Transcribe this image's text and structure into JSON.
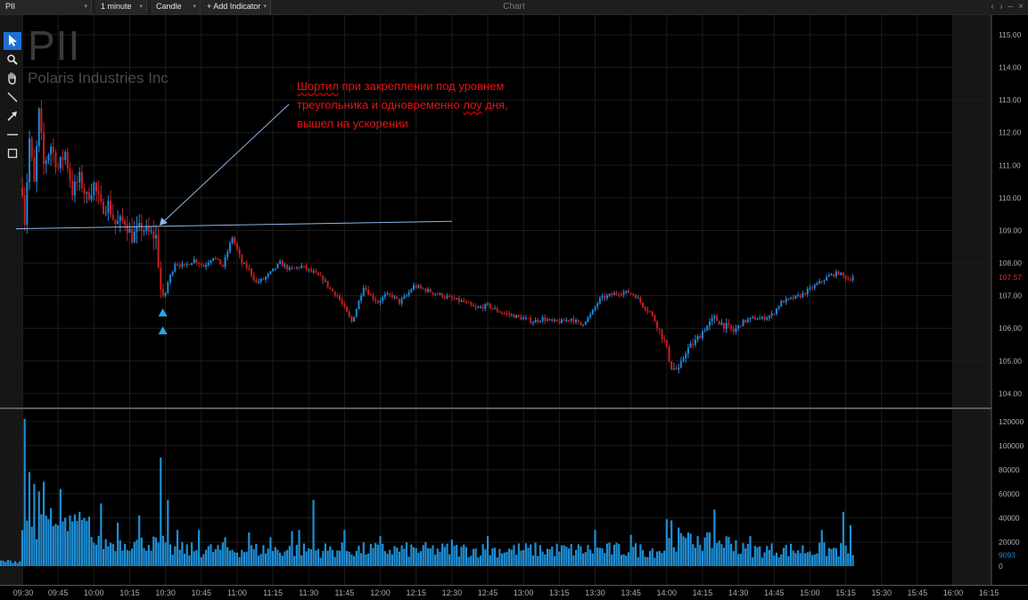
{
  "toolbar": {
    "symbol": "PII",
    "interval": "1 minute",
    "chart_style": "Candle",
    "add_indicator": "+ Add Indicator",
    "window_title": "Chart"
  },
  "tools": [
    "pointer-icon",
    "zoom-icon",
    "hand-icon",
    "line-icon",
    "arrow-icon",
    "horizontal-line-icon",
    "rectangle-icon"
  ],
  "header": {
    "symbol": "PII",
    "company": "Polaris Industries Inc"
  },
  "annotation": {
    "word1": "Шортил",
    "part1": " при закреплении под уровнем треугольника и одновременно ",
    "word2": "лоу",
    "part2": " дня, вышел на ускорении"
  },
  "colors": {
    "up": "#1e88d8",
    "down": "#c81e1e",
    "volume": "#1e8fd6",
    "grid": "#1c1c1c",
    "annotation_line": "#8ab8e6",
    "marker": "#2aa4ea",
    "price_label": "#d23232"
  },
  "chart_data": {
    "type": "candlestick",
    "symbol": "PII",
    "interval": "1 minute",
    "title": "",
    "xlabel": "",
    "ylabel": "",
    "price_ylim": [
      103.6,
      115.6
    ],
    "price_ticks": [
      115,
      114,
      113,
      112,
      111,
      110,
      109,
      108,
      107,
      106,
      105,
      104
    ],
    "price_tick_labels": [
      "115.00",
      "114.00",
      "113.00",
      "112.00",
      "111.00",
      "110.00",
      "109.00",
      "108.00",
      "107.00",
      "106.00",
      "105.00",
      "104.00"
    ],
    "last_price": 107.57,
    "last_price_label": "107.57",
    "volume_ylim": [
      0,
      125000
    ],
    "volume_ticks": [
      0,
      20000,
      40000,
      60000,
      80000,
      100000,
      120000
    ],
    "volume_tick_labels": [
      "0",
      "20000",
      "40000",
      "60000",
      "80000",
      "100000",
      "120000"
    ],
    "last_volume": 9093,
    "last_volume_label": "9093",
    "x_ticks": [
      "09:30",
      "09:45",
      "10:00",
      "10:15",
      "10:30",
      "10:45",
      "11:00",
      "11:15",
      "11:30",
      "11:45",
      "12:00",
      "12:15",
      "12:30",
      "12:45",
      "13:00",
      "13:15",
      "13:30",
      "13:45",
      "14:00",
      "14:15",
      "14:30",
      "14:45",
      "15:00",
      "15:15",
      "15:30",
      "15:45",
      "16:00",
      "16:15"
    ],
    "session": [
      "09:30",
      "16:00"
    ],
    "level_line": {
      "type": "horizontal-trendline",
      "start": [
        "09:30",
        109.05
      ],
      "end": [
        "12:30",
        109.28
      ]
    },
    "arrow": {
      "from": [
        "11:45",
        112.0
      ],
      "to": [
        "10:32",
        109.05
      ]
    },
    "markers": [
      {
        "time": "10:30",
        "price": 106.5,
        "shape": "triangle-up"
      },
      {
        "time": "10:30",
        "price": 105.95,
        "shape": "triangle-up"
      }
    ],
    "price_path": [
      [
        "09:30",
        110.3
      ],
      [
        "09:31",
        109.3
      ],
      [
        "09:33",
        111.8
      ],
      [
        "09:35",
        110.4
      ],
      [
        "09:37",
        112.6
      ],
      [
        "09:39",
        111.0
      ],
      [
        "09:42",
        111.6
      ],
      [
        "09:45",
        110.9
      ],
      [
        "09:48",
        111.4
      ],
      [
        "09:51",
        110.2
      ],
      [
        "09:54",
        110.6
      ],
      [
        "09:57",
        110.0
      ],
      [
        "10:00",
        110.4
      ],
      [
        "10:03",
        109.7
      ],
      [
        "10:06",
        109.8
      ],
      [
        "10:09",
        109.2
      ],
      [
        "10:13",
        109.3
      ],
      [
        "10:16",
        108.8
      ],
      [
        "10:20",
        109.1
      ],
      [
        "10:23",
        108.9
      ],
      [
        "10:26",
        108.8
      ],
      [
        "10:27",
        108.0
      ],
      [
        "10:28",
        107.2
      ],
      [
        "10:29",
        106.8
      ],
      [
        "10:31",
        107.4
      ],
      [
        "10:34",
        108.0
      ],
      [
        "10:38",
        107.9
      ],
      [
        "10:42",
        108.1
      ],
      [
        "10:46",
        107.9
      ],
      [
        "10:50",
        108.2
      ],
      [
        "10:54",
        107.9
      ],
      [
        "10:58",
        108.8
      ],
      [
        "11:02",
        108.0
      ],
      [
        "11:05",
        107.8
      ],
      [
        "11:08",
        107.4
      ],
      [
        "11:11",
        107.5
      ],
      [
        "11:14",
        107.7
      ],
      [
        "11:18",
        108.0
      ],
      [
        "11:22",
        107.8
      ],
      [
        "11:27",
        107.9
      ],
      [
        "11:32",
        107.7
      ],
      [
        "11:36",
        107.5
      ],
      [
        "11:39",
        107.2
      ],
      [
        "11:42",
        107.0
      ],
      [
        "11:45",
        106.6
      ],
      [
        "11:48",
        106.2
      ],
      [
        "11:50",
        106.6
      ],
      [
        "11:53",
        107.3
      ],
      [
        "11:56",
        107.0
      ],
      [
        "11:59",
        106.8
      ],
      [
        "12:02",
        107.0
      ],
      [
        "12:05",
        107.0
      ],
      [
        "12:08",
        106.8
      ],
      [
        "12:11",
        107.0
      ],
      [
        "12:14",
        107.3
      ],
      [
        "12:18",
        107.2
      ],
      [
        "12:22",
        107.1
      ],
      [
        "12:26",
        107.0
      ],
      [
        "12:30",
        106.9
      ],
      [
        "12:35",
        106.8
      ],
      [
        "12:40",
        106.6
      ],
      [
        "12:45",
        106.7
      ],
      [
        "12:50",
        106.5
      ],
      [
        "12:55",
        106.4
      ],
      [
        "13:00",
        106.3
      ],
      [
        "13:04",
        106.2
      ],
      [
        "13:08",
        106.3
      ],
      [
        "13:12",
        106.2
      ],
      [
        "13:16",
        106.2
      ],
      [
        "13:20",
        106.3
      ],
      [
        "13:24",
        106.1
      ],
      [
        "13:28",
        106.4
      ],
      [
        "13:32",
        106.9
      ],
      [
        "13:36",
        107.0
      ],
      [
        "13:40",
        107.1
      ],
      [
        "13:44",
        107.1
      ],
      [
        "13:47",
        107.0
      ],
      [
        "13:50",
        106.7
      ],
      [
        "13:53",
        106.5
      ],
      [
        "13:56",
        106.1
      ],
      [
        "13:59",
        105.6
      ],
      [
        "14:02",
        104.8
      ],
      [
        "14:05",
        104.7
      ],
      [
        "14:08",
        105.3
      ],
      [
        "14:12",
        105.6
      ],
      [
        "14:16",
        106.0
      ],
      [
        "14:20",
        106.3
      ],
      [
        "14:24",
        106.1
      ],
      [
        "14:28",
        105.9
      ],
      [
        "14:32",
        106.2
      ],
      [
        "14:36",
        106.3
      ],
      [
        "14:40",
        106.3
      ],
      [
        "14:44",
        106.4
      ],
      [
        "14:48",
        106.8
      ],
      [
        "14:52",
        106.9
      ],
      [
        "14:56",
        107.0
      ],
      [
        "15:00",
        107.2
      ],
      [
        "15:04",
        107.4
      ],
      [
        "15:08",
        107.6
      ],
      [
        "15:12",
        107.7
      ],
      [
        "15:16",
        107.5
      ],
      [
        "15:18",
        107.57
      ]
    ],
    "volume_peaks": [
      [
        "09:31",
        122000
      ],
      [
        "09:33",
        78000
      ],
      [
        "09:35",
        68000
      ],
      [
        "09:37",
        62000
      ],
      [
        "09:39",
        70000
      ],
      [
        "09:42",
        48000
      ],
      [
        "09:46",
        64000
      ],
      [
        "09:50",
        42000
      ],
      [
        "09:54",
        45000
      ],
      [
        "10:03",
        52000
      ],
      [
        "10:10",
        36000
      ],
      [
        "10:19",
        42000
      ],
      [
        "10:28",
        90000
      ],
      [
        "10:31",
        55000
      ],
      [
        "10:35",
        30000
      ],
      [
        "10:44",
        30000
      ],
      [
        "10:55",
        24000
      ],
      [
        "11:05",
        28000
      ],
      [
        "11:14",
        24000
      ],
      [
        "11:23",
        29000
      ],
      [
        "11:26",
        30000
      ],
      [
        "11:32",
        55000
      ],
      [
        "11:45",
        30000
      ],
      [
        "12:00",
        25000
      ],
      [
        "12:30",
        22000
      ],
      [
        "12:45",
        25000
      ],
      [
        "13:30",
        30000
      ],
      [
        "13:45",
        26000
      ],
      [
        "14:00",
        39000
      ],
      [
        "14:02",
        38000
      ],
      [
        "14:05",
        32000
      ],
      [
        "14:09",
        28000
      ],
      [
        "14:13",
        25000
      ],
      [
        "14:20",
        47000
      ],
      [
        "14:35",
        25000
      ],
      [
        "15:05",
        30000
      ],
      [
        "15:14",
        45000
      ],
      [
        "15:17",
        34000
      ]
    ]
  }
}
